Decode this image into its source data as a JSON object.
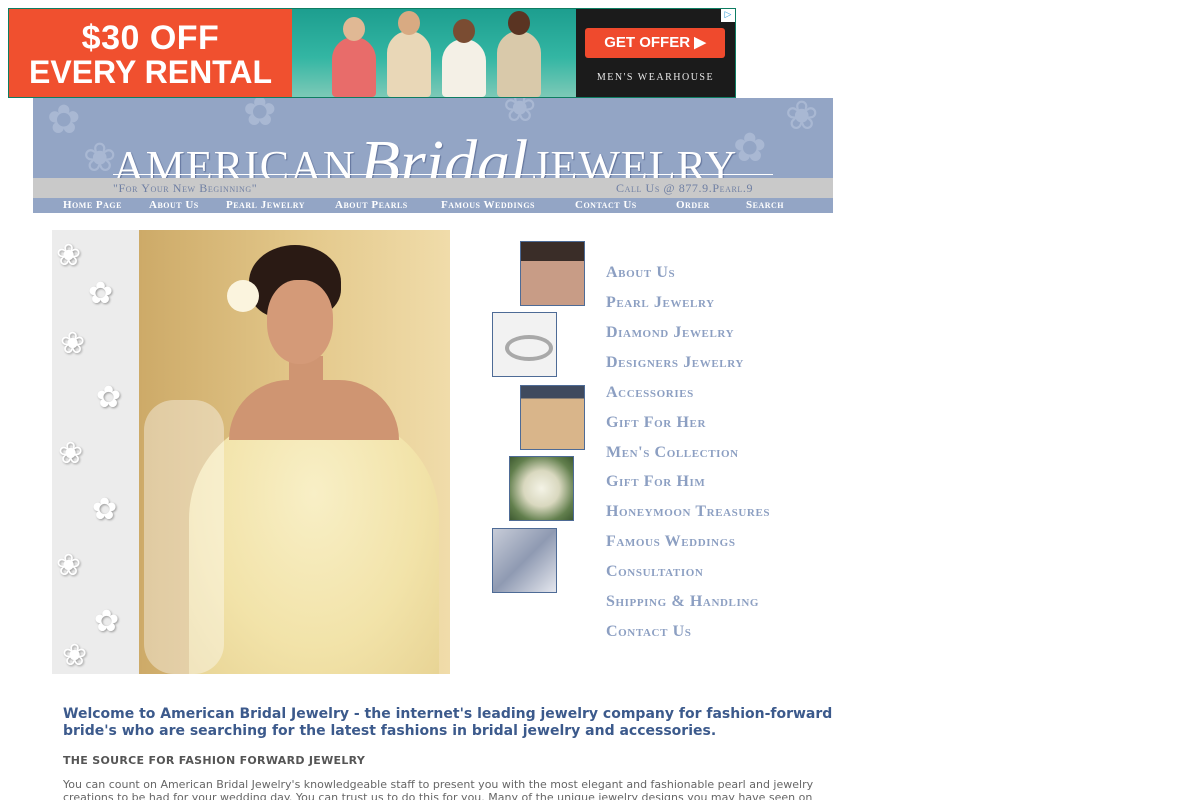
{
  "ad": {
    "headline_line1": "$30 OFF",
    "headline_line2": "EVERY RENTAL",
    "cta": "GET OFFER ▶",
    "brand": "MEN'S WEARHOUSE",
    "adchoices_icon": "▷",
    "colors": {
      "accent": "#f0502f",
      "dark": "#1b1b1b",
      "teal": "#1d9e8f"
    }
  },
  "header": {
    "logo_part1": "AMERICAN",
    "logo_part2": "Bridal",
    "logo_part3": "JEWELRY",
    "tagline": "\"For Your New Beginning\"",
    "phone": "Call Us @ 877.9.Pearl.9",
    "nav": [
      "Home Page",
      "About Us",
      "Pearl Jewelry",
      "About Pearls",
      "Famous Weddings",
      "Contact Us",
      "Order",
      "Search"
    ],
    "colors": {
      "band": "#93a5c5",
      "tag_band": "#c9c9c9"
    }
  },
  "categories": [
    "About Us",
    "Pearl Jewelry",
    "Diamond Jewelry",
    "Designers Jewelry",
    "Accessories",
    "Gift For Her",
    "Men's Collection",
    "Gift For Him",
    "Honeymoon Treasures",
    "Famous Weddings",
    "Consultation",
    "Shipping & Handling",
    "Contact Us"
  ],
  "welcome": {
    "headline": "Welcome to American Bridal Jewelry - the internet's leading jewelry company for fashion-forward bride's who are searching for the latest fashions in bridal jewelry and accessories.",
    "subhead": "THE SOURCE FOR FASHION FORWARD JEWELRY",
    "body": "You can count on American Bridal Jewelry's knowledgeable staff to present you with the most elegant and fashionable pearl and jewelry creations to be had for your wedding day. You can trust us to do this for you. Many of the unique jewelry designs you may have seen on"
  }
}
